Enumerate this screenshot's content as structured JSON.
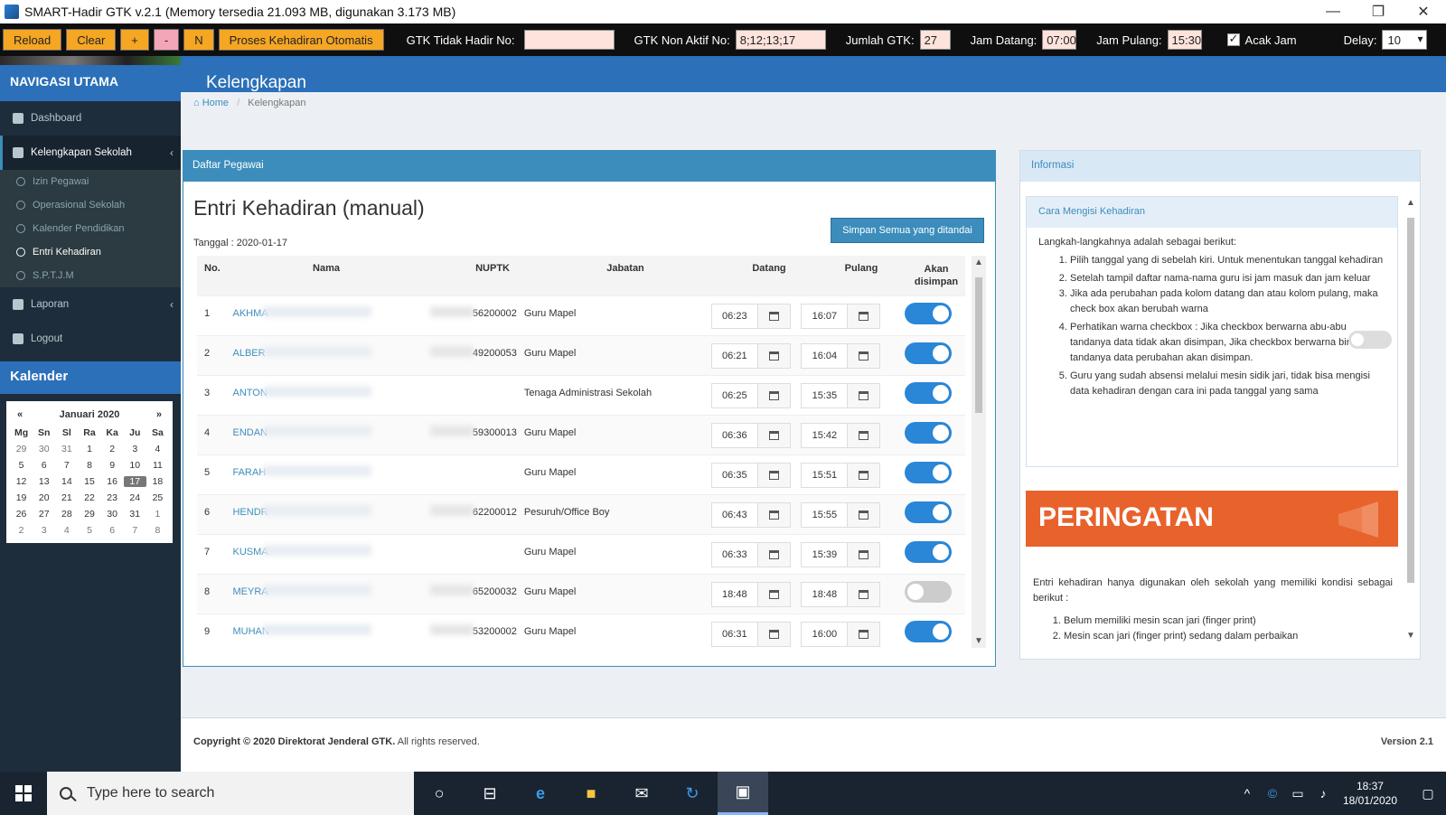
{
  "window": {
    "title": "SMART-Hadir GTK v.2.1 (Memory tersedia 21.093 MB, digunakan 3.173 MB)",
    "min": "—",
    "max": "❐",
    "close": "✕"
  },
  "toolbar": {
    "reload": "Reload",
    "clear": "Clear",
    "plus": "+",
    "minus": "-",
    "n": "N",
    "proses": "Proses Kehadiran Otomatis",
    "tidak_hadir_label": "GTK Tidak Hadir No:",
    "tidak_hadir_value": "",
    "non_aktif_label": "GTK Non Aktif No:",
    "non_aktif_value": "8;12;13;17",
    "jumlah_label": "Jumlah GTK:",
    "jumlah_value": "27",
    "jam_datang_label": "Jam Datang:",
    "jam_datang_value": "07:00",
    "jam_pulang_label": "Jam Pulang:",
    "jam_pulang_value": "15:30",
    "acak_label": "Acak Jam",
    "acak_checked": true,
    "delay_label": "Delay:",
    "delay_value": "10"
  },
  "sidebar": {
    "nav_title": "NAVIGASI UTAMA",
    "dashboard": "Dashboard",
    "kelengkapan": "Kelengkapan Sekolah",
    "sub": [
      "Izin Pegawai",
      "Operasional Sekolah",
      "Kalender Pendidikan",
      "Entri Kehadiran",
      "S.P.T.J.M"
    ],
    "laporan": "Laporan",
    "logout": "Logout",
    "calendar_title": "Kalender"
  },
  "calendar": {
    "prev": "«",
    "next": "»",
    "month": "Januari 2020",
    "dow": [
      "Mg",
      "Sn",
      "Sl",
      "Ra",
      "Ka",
      "Ju",
      "Sa"
    ],
    "weeks": [
      [
        "29",
        "30",
        "31",
        "1",
        "2",
        "3",
        "4"
      ],
      [
        "5",
        "6",
        "7",
        "8",
        "9",
        "10",
        "11"
      ],
      [
        "12",
        "13",
        "14",
        "15",
        "16",
        "17",
        "18"
      ],
      [
        "19",
        "20",
        "21",
        "22",
        "23",
        "24",
        "25"
      ],
      [
        "26",
        "27",
        "28",
        "29",
        "30",
        "31",
        "1"
      ],
      [
        "2",
        "3",
        "4",
        "5",
        "6",
        "7",
        "8"
      ]
    ],
    "selected": "17"
  },
  "main": {
    "header": "Kelengkapan",
    "breadcrumb_home": "Home",
    "breadcrumb_sep": "/",
    "breadcrumb_current": "Kelengkapan",
    "panel_head": "Daftar Pegawai",
    "title": "Entri Kehadiran (manual)",
    "date": "Tanggal : 2020-01-17",
    "save_all": "Simpan Semua yang ditandai",
    "columns": {
      "no": "No.",
      "nama": "Nama",
      "nuptk": "NUPTK",
      "jabatan": "Jabatan",
      "datang": "Datang",
      "pulang": "Pulang",
      "akan": "Akan disimpan"
    },
    "rows": [
      {
        "no": "1",
        "nama": "AKHMA",
        "nuptk": "56200002",
        "jabatan": "Guru Mapel",
        "datang": "06:23",
        "pulang": "16:07",
        "save": true
      },
      {
        "no": "2",
        "nama": "ALBER",
        "nuptk": "49200053",
        "jabatan": "Guru Mapel",
        "datang": "06:21",
        "pulang": "16:04",
        "save": true
      },
      {
        "no": "3",
        "nama": "ANTON",
        "nuptk": "",
        "jabatan": "Tenaga Administrasi Sekolah",
        "datang": "06:25",
        "pulang": "15:35",
        "save": true
      },
      {
        "no": "4",
        "nama": "ENDAN",
        "nuptk": "59300013",
        "jabatan": "Guru Mapel",
        "datang": "06:36",
        "pulang": "15:42",
        "save": true
      },
      {
        "no": "5",
        "nama": "FARAH",
        "nuptk": "",
        "jabatan": "Guru Mapel",
        "datang": "06:35",
        "pulang": "15:51",
        "save": true
      },
      {
        "no": "6",
        "nama": "HENDR",
        "nuptk": "62200012",
        "jabatan": "Pesuruh/Office Boy",
        "datang": "06:43",
        "pulang": "15:55",
        "save": true
      },
      {
        "no": "7",
        "nama": "KUSMA",
        "nuptk": "",
        "jabatan": "Guru Mapel",
        "datang": "06:33",
        "pulang": "15:39",
        "save": true
      },
      {
        "no": "8",
        "nama": "MEYRA",
        "nuptk": "65200032",
        "jabatan": "Guru Mapel",
        "datang": "18:48",
        "pulang": "18:48",
        "save": false
      },
      {
        "no": "9",
        "nama": "MUHAN",
        "nuptk": "53200002",
        "jabatan": "Guru Mapel",
        "datang": "06:31",
        "pulang": "16:00",
        "save": true
      }
    ]
  },
  "info": {
    "head": "Informasi",
    "box_head": "Cara Mengisi Kehadiran",
    "intro": "Langkah-langkahnya adalah sebagai berikut:",
    "steps": [
      "Pilih tanggal yang di sebelah kiri. Untuk menentukan tanggal kehadiran",
      "Setelah tampil daftar nama-nama guru isi jam masuk dan jam keluar",
      "Jika ada perubahan pada kolom datang dan atau kolom pulang, maka check box akan berubah warna",
      "Perhatikan warna checkbox : Jika checkbox berwarna abu-abu tandanya data tidak akan disimpan, Jika checkbox berwarna biru tandanya data perubahan akan disimpan.",
      "Guru yang sudah absensi melalui mesin sidik jari, tidak bisa mengisi data kehadiran dengan cara ini pada tanggal yang sama"
    ],
    "warning_title": "PERINGATAN",
    "warning_text": "Entri kehadiran hanya digunakan oleh sekolah yang memiliki kondisi sebagai berikut :",
    "warning_list": [
      "Belum memiliki mesin scan jari (finger print)",
      "Mesin scan jari (finger print) sedang dalam perbaikan"
    ]
  },
  "footer": {
    "copyright": "Copyright © 2020 Direktorat Jenderal GTK.",
    "rights": "All rights reserved.",
    "version": "Version 2.1"
  },
  "taskbar": {
    "search_placeholder": "Type here to search",
    "time": "18:37",
    "date": "18/01/2020"
  }
}
